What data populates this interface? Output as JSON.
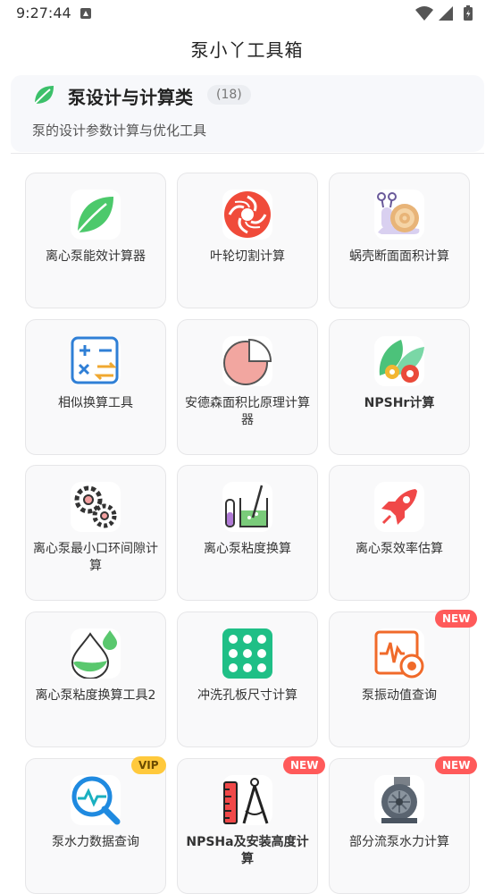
{
  "status_bar": {
    "time": "9:27:44"
  },
  "app": {
    "title": "泵小丫工具箱"
  },
  "category": {
    "name": "泵设计与计算类",
    "count": "(18)",
    "description": "泵的设计参数计算与优化工具"
  },
  "badges": {
    "new": "NEW",
    "vip": "VIP"
  },
  "tools": [
    {
      "label": "离心泵能效计算器",
      "icon": "leaf-icon"
    },
    {
      "label": "叶轮切割计算",
      "icon": "impeller-icon"
    },
    {
      "label": "蜗壳断面面积计算",
      "icon": "snail-icon"
    },
    {
      "label": "相似换算工具",
      "icon": "calculator-icon"
    },
    {
      "label": "安德森面积比原理计算器",
      "icon": "pie-chart-icon"
    },
    {
      "label": "NPSHr计算",
      "icon": "leaf-gear-icon"
    },
    {
      "label": "离心泵最小口环间隙计算",
      "icon": "gears-icon"
    },
    {
      "label": "离心泵粘度换算",
      "icon": "lab-beaker-icon"
    },
    {
      "label": "离心泵效率估算",
      "icon": "rocket-icon"
    },
    {
      "label": "离心泵粘度换算工具2",
      "icon": "droplet-icon"
    },
    {
      "label": "冲洗孔板尺寸计算",
      "icon": "orifice-plate-icon"
    },
    {
      "label": "泵振动值查询",
      "icon": "vibration-monitor-icon",
      "badge": "new"
    },
    {
      "label": "泵水力数据查询",
      "icon": "magnifier-chart-icon",
      "badge": "vip"
    },
    {
      "label": "NPSHa及安装高度计算",
      "icon": "ruler-compass-icon",
      "badge": "new"
    },
    {
      "label": "部分流泵水力计算",
      "icon": "pump-icon",
      "badge": "new"
    }
  ]
}
